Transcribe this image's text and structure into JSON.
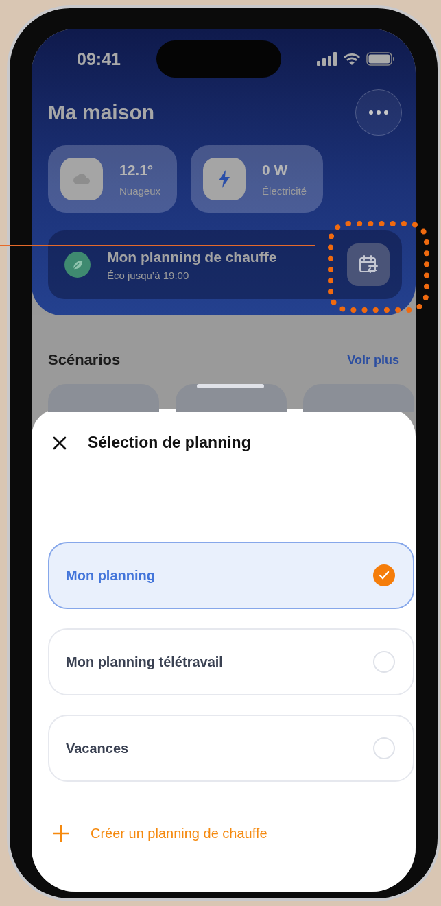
{
  "status_bar": {
    "time": "09:41"
  },
  "header": {
    "title": "Ma maison"
  },
  "stats": [
    {
      "kind": "weather",
      "value": "12.1°",
      "label": "Nuageux"
    },
    {
      "kind": "power",
      "value": "0 W",
      "label": "Électricité"
    }
  ],
  "planning_card": {
    "title": "Mon planning de chauffe",
    "subtitle": "Éco jusqu’à 19:00"
  },
  "scenarios": {
    "title": "Scénarios",
    "link": "Voir plus"
  },
  "sheet": {
    "title": "Sélection de planning",
    "options": [
      {
        "label": "Mon planning",
        "selected": true
      },
      {
        "label": "Mon planning télétravail",
        "selected": false
      },
      {
        "label": "Vacances",
        "selected": false
      }
    ],
    "create_action": "Créer un planning de chauffe"
  }
}
